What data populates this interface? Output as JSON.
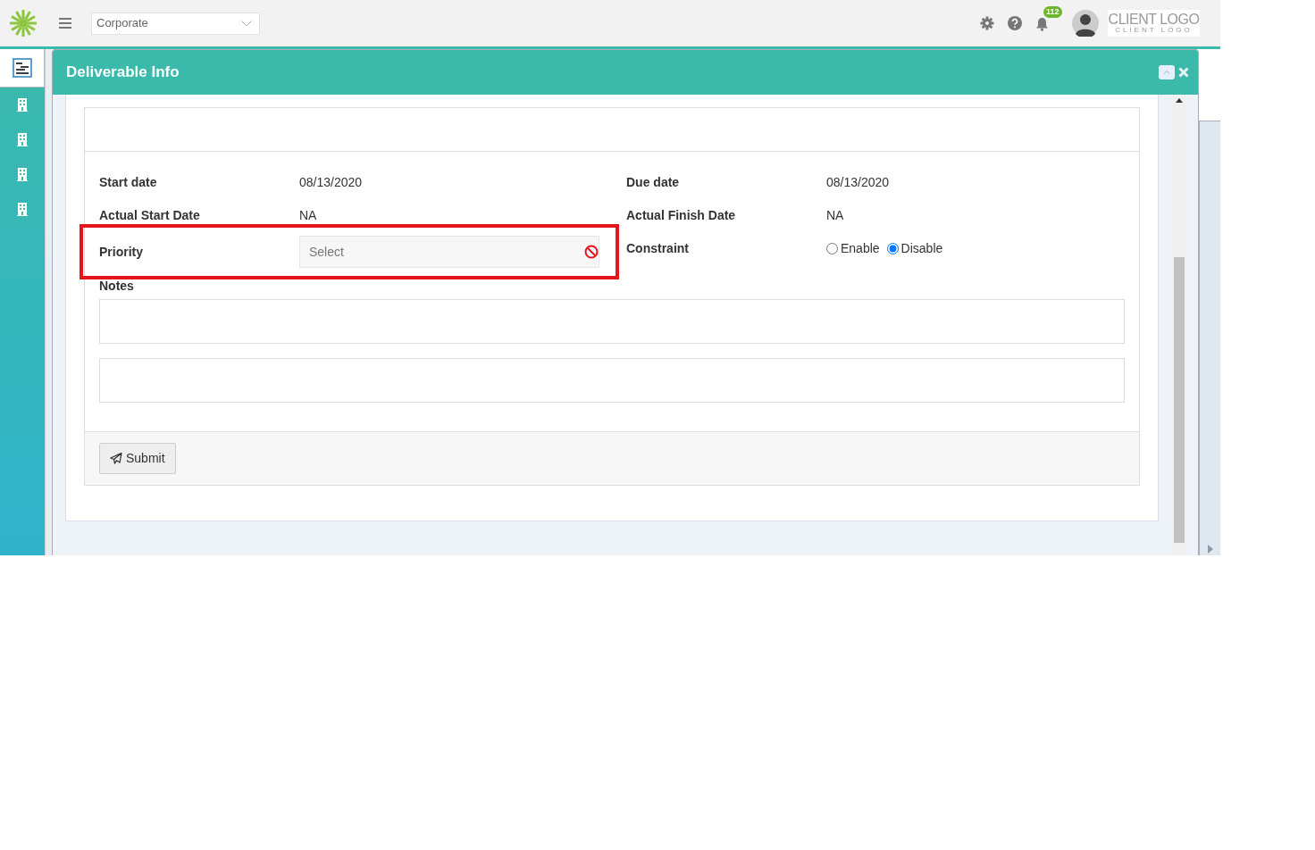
{
  "topbar": {
    "company_select": {
      "value": "Corporate"
    },
    "notification_count": "112",
    "client_logo": {
      "title": "CLIENT LOGO",
      "subtitle": "CLIENT LOGO"
    }
  },
  "sidebar": {
    "items": [
      {
        "kind": "document",
        "selected": true
      },
      {
        "kind": "building",
        "selected": false
      },
      {
        "kind": "building",
        "selected": false
      },
      {
        "kind": "building",
        "selected": false
      },
      {
        "kind": "building",
        "selected": false
      }
    ]
  },
  "modal": {
    "title": "Deliverable Info",
    "fields": [
      {
        "kind": "text",
        "label": "Start date",
        "value": "08/13/2020"
      },
      {
        "kind": "text",
        "label": "Due date",
        "value": "08/13/2020"
      },
      {
        "kind": "text",
        "label": "Actual Start Date",
        "value": "NA"
      },
      {
        "kind": "text",
        "label": "Actual Finish Date",
        "value": "NA"
      },
      {
        "kind": "select",
        "label": "Priority",
        "placeholder": "Select",
        "highlighted": true
      },
      {
        "kind": "radio",
        "label": "Constraint",
        "options": [
          {
            "label": "Enable",
            "selected": false
          },
          {
            "label": "Disable",
            "selected": true
          }
        ]
      }
    ],
    "notes": {
      "label": "Notes",
      "boxes": [
        {
          "kind": "textarea"
        },
        {
          "kind": "textarea"
        }
      ]
    },
    "submit": "Submit"
  }
}
